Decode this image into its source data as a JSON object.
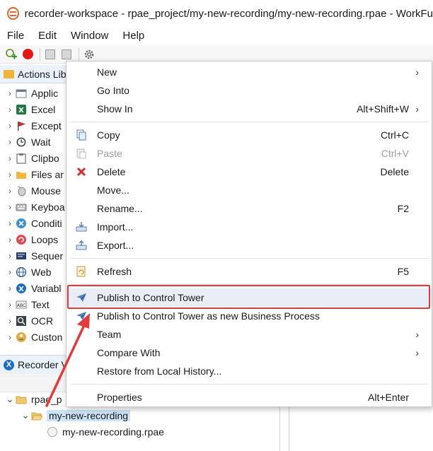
{
  "window": {
    "title": "recorder-workspace - rpae_project/my-new-recording/my-new-recording.rpae - WorkFu"
  },
  "menubar": {
    "items": [
      "File",
      "Edit",
      "Window",
      "Help"
    ]
  },
  "toolbar": {
    "icons": [
      "new-recording-icon",
      "record-icon",
      "save-icon",
      "save-all-icon",
      "settings-icon"
    ]
  },
  "actions_panel": {
    "tab_label": "Actions Lib",
    "items": [
      {
        "label": "Applic",
        "icon": "application-icon"
      },
      {
        "label": "Excel",
        "icon": "excel-icon"
      },
      {
        "label": "Except",
        "icon": "exception-flag-icon"
      },
      {
        "label": "Wait",
        "icon": "clock-icon"
      },
      {
        "label": "Clipbo",
        "icon": "clipboard-icon"
      },
      {
        "label": "Files ar",
        "icon": "folder-icon"
      },
      {
        "label": "Mouse",
        "icon": "mouse-icon"
      },
      {
        "label": "Keyboa",
        "icon": "keyboard-icon"
      },
      {
        "label": "Conditi",
        "icon": "condition-icon"
      },
      {
        "label": "Loops",
        "icon": "loop-icon"
      },
      {
        "label": "Sequer",
        "icon": "sequence-icon"
      },
      {
        "label": "Web",
        "icon": "globe-icon"
      },
      {
        "label": "Variabl",
        "icon": "variable-icon"
      },
      {
        "label": "Text",
        "icon": "text-icon"
      },
      {
        "label": "OCR",
        "icon": "ocr-icon"
      },
      {
        "label": "Custon",
        "icon": "custom-icon"
      }
    ]
  },
  "recorder_panel": {
    "tab_label": "Recorder V",
    "tree": [
      {
        "label": "rpae_p",
        "level": 0
      },
      {
        "label": "my-new-recording",
        "level": 1,
        "selected": true
      },
      {
        "label": "my-new-recording.rpae",
        "level": 2
      }
    ]
  },
  "context_menu": {
    "items": [
      {
        "label": "New",
        "shortcut": "",
        "submenu": true
      },
      {
        "label": "Go Into",
        "shortcut": ""
      },
      {
        "label": "Show In",
        "shortcut": "Alt+Shift+W",
        "submenu": true
      },
      {
        "label": "Copy",
        "shortcut": "Ctrl+C",
        "icon": "copy-icon"
      },
      {
        "label": "Paste",
        "shortcut": "Ctrl+V",
        "icon": "paste-icon",
        "disabled": true
      },
      {
        "label": "Delete",
        "shortcut": "Delete",
        "icon": "delete-icon"
      },
      {
        "label": "Move...",
        "shortcut": ""
      },
      {
        "label": "Rename...",
        "shortcut": "F2"
      },
      {
        "label": "Import...",
        "shortcut": "",
        "icon": "import-icon"
      },
      {
        "label": "Export...",
        "shortcut": "",
        "icon": "export-icon"
      },
      {
        "label": "Refresh",
        "shortcut": "F5",
        "icon": "refresh-icon"
      },
      {
        "label": "Publish to Control Tower",
        "shortcut": "",
        "icon": "paper-plane-icon",
        "highlighted": true
      },
      {
        "label": "Publish to Control Tower as new Business Process",
        "shortcut": "",
        "icon": "paper-plane-icon"
      },
      {
        "label": "Team",
        "shortcut": "",
        "submenu": true
      },
      {
        "label": "Compare With",
        "shortcut": "",
        "submenu": true
      },
      {
        "label": "Restore from Local History...",
        "shortcut": ""
      },
      {
        "label": "Properties",
        "shortcut": "Alt+Enter"
      }
    ]
  },
  "annotation": {
    "box_color": "#e63a3a",
    "arrow_color": "#e63a3a"
  }
}
